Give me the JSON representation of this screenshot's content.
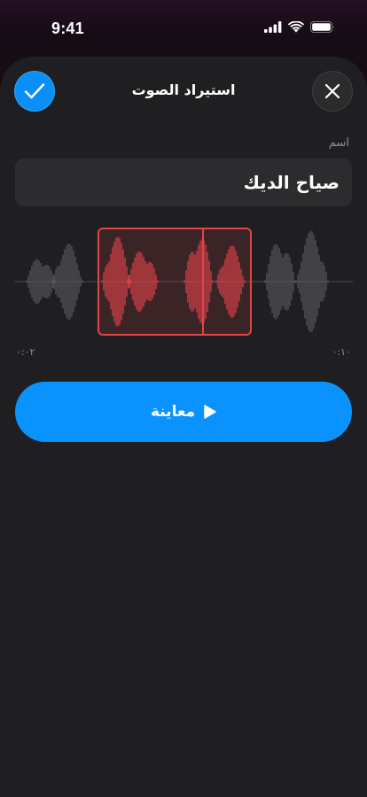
{
  "status_bar": {
    "time": "9:41",
    "icons": [
      "cellular-signal-icon",
      "wifi-icon",
      "battery-icon"
    ]
  },
  "sheet": {
    "title": "استيراد الصوت",
    "confirm_icon": "checkmark-icon",
    "close_icon": "close-icon"
  },
  "name_field": {
    "label": "اسم",
    "value": "صياح الديك"
  },
  "trimmer": {
    "start_time": "٠:٠٢",
    "end_time": "٠:١٠",
    "selection_color": "#e2444a",
    "waveform_color": "#5a5a5e"
  },
  "preview_button": {
    "label": "معاينة",
    "icon": "play-icon"
  },
  "colors": {
    "accent": "#0a93ff",
    "sheet_background": "#1f1f21",
    "field_background": "#2c2c2f"
  }
}
